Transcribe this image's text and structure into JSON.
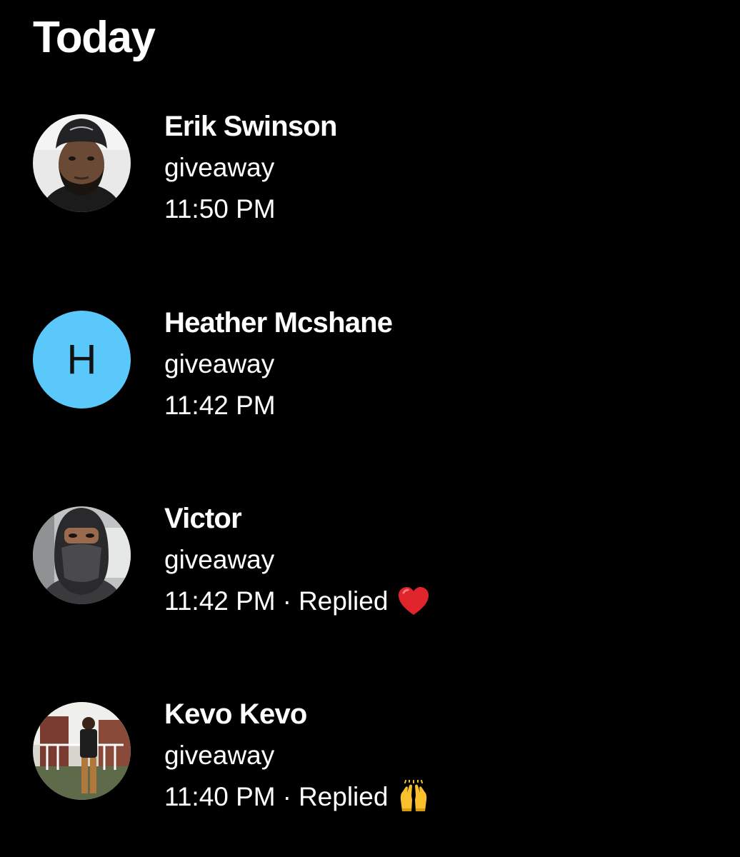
{
  "section": {
    "title": "Today"
  },
  "replied_label": "Replied",
  "separator": "·",
  "messages": [
    {
      "name": "Erik Swinson",
      "preview": "giveaway",
      "time": "11:50 PM",
      "avatar": "photo",
      "replied": false
    },
    {
      "name": "Heather Mcshane",
      "preview": "giveaway",
      "time": "11:42 PM",
      "avatar": "initial",
      "initial": "H",
      "avatar_color": "#5AC8FA",
      "replied": false
    },
    {
      "name": "Victor",
      "preview": "giveaway",
      "time": "11:42 PM",
      "avatar": "photo",
      "replied": true,
      "reaction_icon": "red-heart-icon"
    },
    {
      "name": "Kevo Kevo",
      "preview": "giveaway",
      "time": "11:40 PM",
      "avatar": "photo",
      "replied": true,
      "reaction_icon": "raising-hands-icon"
    }
  ]
}
